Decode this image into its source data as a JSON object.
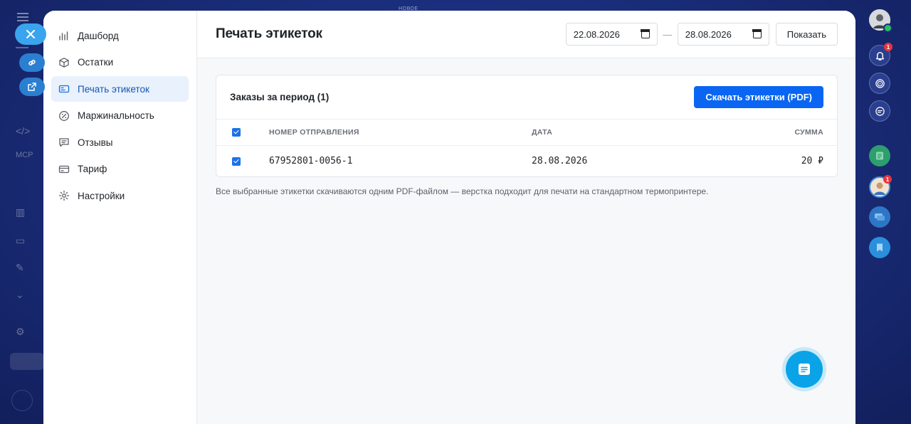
{
  "background": {
    "top_label": "НОВОЕ"
  },
  "sidebar": {
    "items": [
      {
        "label": "Дашборд",
        "icon": "bar-chart-icon"
      },
      {
        "label": "Остатки",
        "icon": "box-icon"
      },
      {
        "label": "Печать этикеток",
        "icon": "label-icon",
        "active": true
      },
      {
        "label": "Маржинальность",
        "icon": "percent-icon"
      },
      {
        "label": "Отзывы",
        "icon": "comment-icon"
      },
      {
        "label": "Тариф",
        "icon": "card-icon"
      },
      {
        "label": "Настройки",
        "icon": "gear-icon"
      }
    ]
  },
  "header": {
    "title": "Печать этикеток",
    "date_from": "22.08.2026",
    "date_separator": "—",
    "date_to": "28.08.2026",
    "show_button": "Показать"
  },
  "orders": {
    "title": "Заказы за период (1)",
    "download_button": "Скачать этикетки (PDF)",
    "columns": {
      "number": "НОМЕР ОТПРАВЛЕНИЯ",
      "date": "ДАТА",
      "sum": "СУММА"
    },
    "rows": [
      {
        "number": "67952801-0056-1",
        "date": "28.08.2026",
        "sum": "20 ₽",
        "checked": true
      }
    ]
  },
  "note": "Все выбранные этикетки скачиваются одним PDF-файлом — верстка подходит для печати на стандартном термопринтере.",
  "rail": {
    "notifications_badge": "1",
    "contact_badge": "1"
  },
  "colors": {
    "accent": "#0a66f2",
    "active_nav_bg": "#e8f1fc",
    "chat_fab": "#0aa3e8",
    "badge": "#e8343f"
  }
}
